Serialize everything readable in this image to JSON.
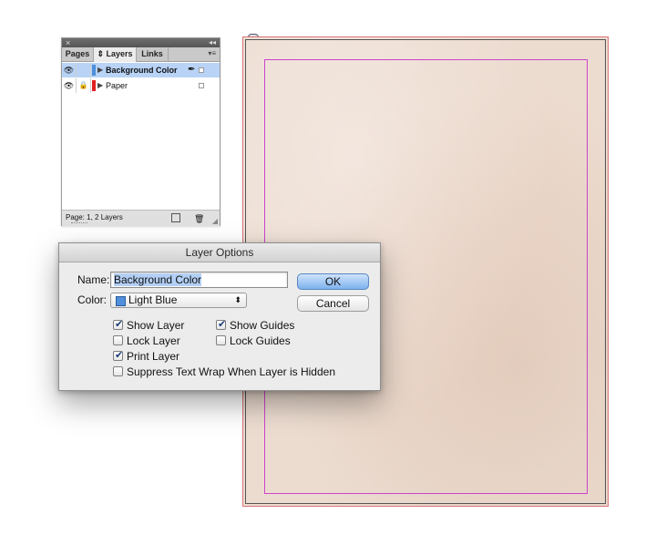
{
  "layers_panel": {
    "close_glyph": "×",
    "collapse_glyph": "◂◂",
    "tabs": [
      {
        "label": "Pages"
      },
      {
        "label": "⇕ Layers"
      },
      {
        "label": "Links"
      }
    ],
    "menu_glyph": "▾≡",
    "layers": [
      {
        "name": "Background Color",
        "color": "#4f8fdb",
        "selected": true
      },
      {
        "name": "Paper",
        "color": "#e02020",
        "selected": false
      }
    ],
    "status_text": "Page: 1, 2 Layers"
  },
  "dialog": {
    "title": "Layer Options",
    "name_label": "Name:",
    "name_value": "Background Color",
    "color_label": "Color:",
    "color_value": "Light Blue",
    "ok_label": "OK",
    "cancel_label": "Cancel",
    "checkboxes": {
      "show_layer": {
        "label": "Show Layer",
        "checked": true
      },
      "show_guides": {
        "label": "Show Guides",
        "checked": true
      },
      "lock_layer": {
        "label": "Lock Layer",
        "checked": false
      },
      "lock_guides": {
        "label": "Lock Guides",
        "checked": false
      },
      "print_layer": {
        "label": "Print Layer",
        "checked": true
      },
      "suppress_wrap": {
        "label": "Suppress Text Wrap When Layer is Hidden",
        "checked": false
      }
    }
  },
  "colors": {
    "page_background": "#ecdcd0",
    "margin_guide": "#cc44cc",
    "selection": "#b8d3f6"
  }
}
